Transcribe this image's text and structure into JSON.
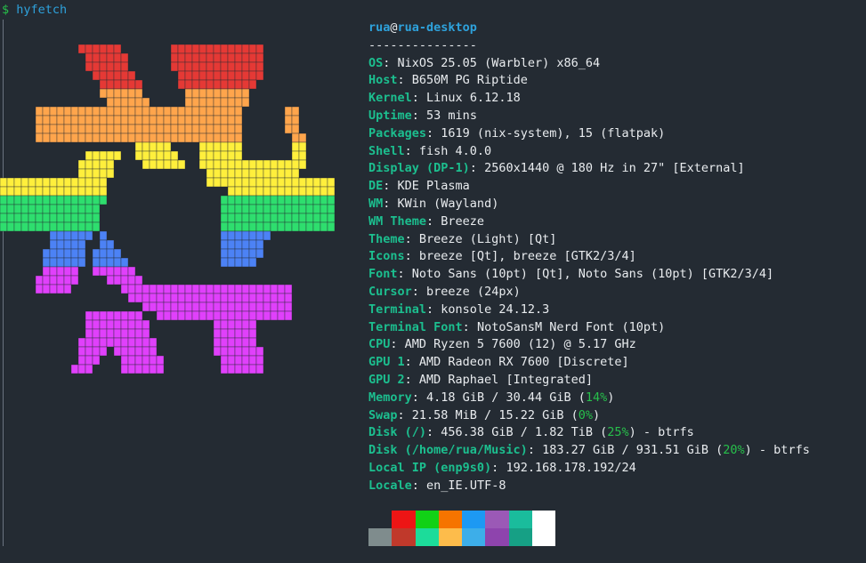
{
  "prompt": {
    "dollar": "$",
    "command": "hyfetch"
  },
  "header": {
    "user": "rua",
    "at": "@",
    "host": "rua-desktop",
    "separator": "---------------"
  },
  "info": [
    {
      "key": "OS",
      "parts": [
        {
          "t": "NixOS 25.05 (Warbler) x86_64"
        }
      ]
    },
    {
      "key": "Host",
      "parts": [
        {
          "t": "B650M PG Riptide"
        }
      ]
    },
    {
      "key": "Kernel",
      "parts": [
        {
          "t": "Linux 6.12.18"
        }
      ]
    },
    {
      "key": "Uptime",
      "parts": [
        {
          "t": "53 mins"
        }
      ]
    },
    {
      "key": "Packages",
      "parts": [
        {
          "t": "1619 (nix-system), 15 (flatpak)"
        }
      ]
    },
    {
      "key": "Shell",
      "parts": [
        {
          "t": "fish 4.0.0"
        }
      ]
    },
    {
      "key": "Display (DP-1)",
      "parts": [
        {
          "t": "2560x1440 @ 180 Hz in 27\" [External]"
        }
      ]
    },
    {
      "key": "DE",
      "parts": [
        {
          "t": "KDE Plasma"
        }
      ]
    },
    {
      "key": "WM",
      "parts": [
        {
          "t": "KWin (Wayland)"
        }
      ]
    },
    {
      "key": "WM Theme",
      "parts": [
        {
          "t": "Breeze"
        }
      ]
    },
    {
      "key": "Theme",
      "parts": [
        {
          "t": "Breeze (Light) [Qt]"
        }
      ]
    },
    {
      "key": "Icons",
      "parts": [
        {
          "t": "breeze [Qt], breeze [GTK2/3/4]"
        }
      ]
    },
    {
      "key": "Font",
      "parts": [
        {
          "t": "Noto Sans (10pt) [Qt], Noto Sans (10pt) [GTK2/3/4]"
        }
      ]
    },
    {
      "key": "Cursor",
      "parts": [
        {
          "t": "breeze (24px)"
        }
      ]
    },
    {
      "key": "Terminal",
      "parts": [
        {
          "t": "konsole 24.12.3"
        }
      ]
    },
    {
      "key": "Terminal Font",
      "parts": [
        {
          "t": "NotoSansM Nerd Font (10pt)"
        }
      ]
    },
    {
      "key": "CPU",
      "parts": [
        {
          "t": "AMD Ryzen 5 7600 (12) @ 5.17 GHz"
        }
      ]
    },
    {
      "key": "GPU 1",
      "parts": [
        {
          "t": "AMD Radeon RX 7600 [Discrete]"
        }
      ]
    },
    {
      "key": "GPU 2",
      "parts": [
        {
          "t": "AMD Raphael [Integrated]"
        }
      ]
    },
    {
      "key": "Memory",
      "parts": [
        {
          "t": "4.18 GiB / 30.44 GiB ("
        },
        {
          "t": "14%",
          "c": "pct"
        },
        {
          "t": ")"
        }
      ]
    },
    {
      "key": "Swap",
      "parts": [
        {
          "t": "21.58 MiB / 15.22 GiB ("
        },
        {
          "t": "0%",
          "c": "pct"
        },
        {
          "t": ")"
        }
      ]
    },
    {
      "key": "Disk (/)",
      "parts": [
        {
          "t": "456.38 GiB / 1.82 TiB ("
        },
        {
          "t": "25%",
          "c": "pct"
        },
        {
          "t": ") - btrfs"
        }
      ]
    },
    {
      "key": "Disk (/home/rua/Music)",
      "parts": [
        {
          "t": "183.27 GiB / 931.51 GiB ("
        },
        {
          "t": "20%",
          "c": "pct"
        },
        {
          "t": ") - btrfs"
        }
      ]
    },
    {
      "key": "Local IP (enp9s0)",
      "parts": [
        {
          "t": "192.168.178.192/24"
        }
      ]
    },
    {
      "key": "Locale",
      "parts": [
        {
          "t": "en_IE.UTF-8"
        }
      ]
    }
  ],
  "palette": {
    "normal": [
      "#242b33",
      "#ed1515",
      "#11d116",
      "#f67400",
      "#1d99f3",
      "#9b59b6",
      "#1abc9c",
      "#ffffff"
    ],
    "bright": [
      "#7f8c8d",
      "#c0392b",
      "#1cdc9a",
      "#fdbc4b",
      "#3daee9",
      "#8e44ad",
      "#16a085",
      "#ffffff"
    ]
  },
  "logo": {
    "flag_colors": [
      "#e53935",
      "#ffa54c",
      "#ffef3c",
      "#2ede6e",
      "#4c82f5",
      "#e040fb"
    ],
    "cell_border": "#242b33"
  }
}
